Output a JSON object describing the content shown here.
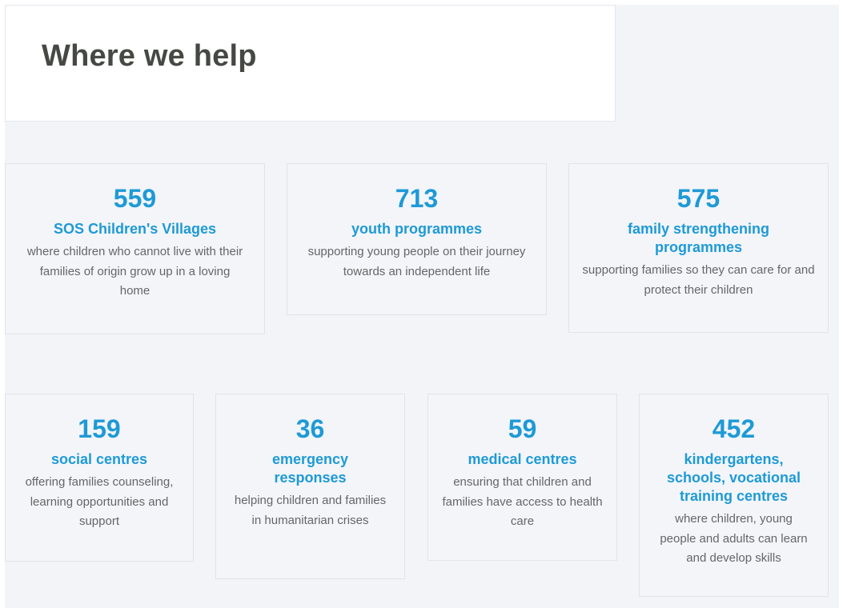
{
  "heading": "Where we help",
  "stats": [
    {
      "number": "559",
      "label": "SOS Children's Villages",
      "description": "where children who cannot live with their families of origin grow up in a loving home"
    },
    {
      "number": "713",
      "label": "youth programmes",
      "description": "supporting young people on their journey towards an independent life"
    },
    {
      "number": "575",
      "label": "family strengthening programmes",
      "description": "supporting families so they can care for and protect their children"
    },
    {
      "number": "159",
      "label": "social centres",
      "description": "offering families counseling, learning opportunities and support"
    },
    {
      "number": "36",
      "label": "emergency responses",
      "description": "helping children and families in humanitarian crises"
    },
    {
      "number": "59",
      "label": "medical centres",
      "description": "ensuring that children and families have access to health care"
    },
    {
      "number": "452",
      "label": "kindergartens, schools, vocational training centres",
      "description": "where children, young people and adults can learn and develop skills"
    }
  ],
  "colors": {
    "accent": "#1e9ad6",
    "heading": "#454843",
    "body_text": "#666666",
    "card_background": "#f3f5f9"
  }
}
